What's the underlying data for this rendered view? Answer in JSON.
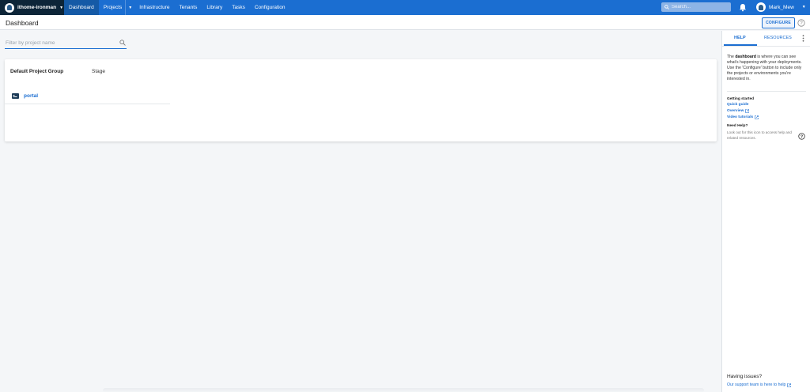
{
  "topnav": {
    "space_name": "ithome-ironman",
    "items": [
      "Dashboard",
      "Projects",
      "Infrastructure",
      "Tenants",
      "Library",
      "Tasks",
      "Configuration"
    ],
    "search_placeholder": "Search...",
    "user_name": "Mark_Mew"
  },
  "header": {
    "title": "Dashboard",
    "configure_label": "CONFIGURE"
  },
  "main": {
    "filter_placeholder": "Filter by project name",
    "group_name": "Default Project Group",
    "stage_label": "Stage",
    "projects": [
      {
        "name": "portal"
      }
    ]
  },
  "panel": {
    "tab_help": "HELP",
    "tab_resources": "RESOURCES",
    "intro_prefix": "The ",
    "intro_bold": "dashboard",
    "intro_suffix": " is where you can see what's happening with your deployments. Use the 'Configure' button to include only the projects or environments you're interested in.",
    "getting_started": "Getting started",
    "links": [
      "Quick guide",
      "Overview",
      "Video tutorials"
    ],
    "need_help_title": "Need Help?",
    "need_help_text": "Look out for this icon to access help and related resources.",
    "issues_title": "Having issues?",
    "issues_link": "Our support team is here to help"
  },
  "colors": {
    "nav_bg": "#1b6ed1",
    "space_bg": "#0d2538",
    "accent": "#1b6ed1"
  },
  "icons": {
    "search": "search-icon",
    "bell": "bell-icon",
    "help": "help-circle-icon",
    "external": "external-link-icon",
    "project": "project-icon"
  }
}
